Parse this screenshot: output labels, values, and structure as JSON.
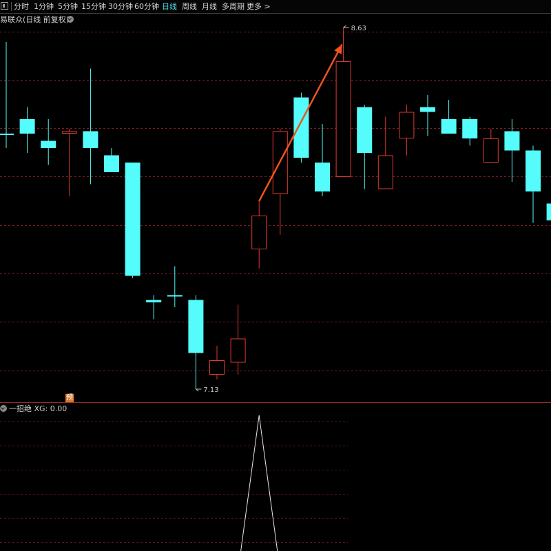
{
  "toolbar": {
    "periods": [
      "分时",
      "1分钟",
      "5分钟",
      "15分钟",
      "30分钟",
      "60分钟",
      "日线",
      "周线",
      "月线",
      "多周期",
      "更多 >"
    ],
    "active_period": "日线"
  },
  "main_pane": {
    "title": "易联众(日线 前复权)",
    "high_label": "8.63",
    "low_label": "7.13"
  },
  "indicator_pane": {
    "title": "一招绝  XG: 0.00"
  },
  "badge": "预",
  "colors": {
    "up": "#e03a2f",
    "down": "#54fcfc",
    "grid": "#7a1c1c",
    "arrow": "#f0531e",
    "active_tab": "#4ee0ee"
  },
  "chart_data": {
    "type": "candlestick",
    "price_range": [
      7.13,
      8.63
    ],
    "candles": [
      {
        "open": 8.19,
        "close": 8.19,
        "high": 8.57,
        "low": 8.13
      },
      {
        "open": 8.25,
        "close": 8.19,
        "high": 8.3,
        "low": 8.11
      },
      {
        "open": 8.16,
        "close": 8.13,
        "high": 8.25,
        "low": 8.06
      },
      {
        "open": 8.19,
        "close": 8.2,
        "high": 8.21,
        "low": 7.93
      },
      {
        "open": 8.2,
        "close": 8.13,
        "high": 8.46,
        "low": 7.98
      },
      {
        "open": 8.1,
        "close": 8.03,
        "high": 8.13,
        "low": 8.03
      },
      {
        "open": 8.07,
        "close": 7.6,
        "high": 8.07,
        "low": 7.59
      },
      {
        "open": 7.5,
        "close": 7.49,
        "high": 7.52,
        "low": 7.42
      },
      {
        "open": 7.52,
        "close": 7.52,
        "high": 7.64,
        "low": 7.47
      },
      {
        "open": 7.5,
        "close": 7.28,
        "high": 7.52,
        "low": 7.13
      },
      {
        "open": 7.19,
        "close": 7.25,
        "high": 7.31,
        "low": 7.17
      },
      {
        "open": 7.24,
        "close": 7.34,
        "high": 7.48,
        "low": 7.19
      },
      {
        "open": 7.71,
        "close": 7.85,
        "high": 7.91,
        "low": 7.63
      },
      {
        "open": 7.94,
        "close": 8.2,
        "high": 8.21,
        "low": 7.77
      },
      {
        "open": 8.34,
        "close": 8.09,
        "high": 8.36,
        "low": 8.07
      },
      {
        "open": 8.07,
        "close": 7.95,
        "high": 8.23,
        "low": 7.93
      },
      {
        "open": 8.01,
        "close": 8.49,
        "high": 8.63,
        "low": 8.01
      },
      {
        "open": 8.3,
        "close": 8.11,
        "high": 8.31,
        "low": 7.96
      },
      {
        "open": 7.96,
        "close": 8.1,
        "high": 8.26,
        "low": 7.98
      },
      {
        "open": 8.17,
        "close": 8.28,
        "high": 8.31,
        "low": 8.1
      },
      {
        "open": 8.3,
        "close": 8.28,
        "high": 8.35,
        "low": 8.18
      },
      {
        "open": 8.25,
        "close": 8.19,
        "high": 8.33,
        "low": 8.2
      },
      {
        "open": 8.25,
        "close": 8.17,
        "high": 8.26,
        "low": 8.14
      },
      {
        "open": 8.07,
        "close": 8.17,
        "high": 8.21,
        "low": 8.1
      },
      {
        "open": 8.2,
        "close": 8.12,
        "high": 8.25,
        "low": 7.99
      },
      {
        "open": 8.12,
        "close": 7.95,
        "high": 8.14,
        "low": 7.82
      },
      {
        "open": 7.9,
        "close": 7.83,
        "high": 7.91,
        "low": 7.71
      }
    ],
    "xg_signal": [
      0,
      0,
      0,
      0,
      0,
      0,
      0,
      0,
      0,
      0,
      0,
      0,
      1,
      0,
      0,
      0,
      0,
      0,
      0,
      0,
      0,
      0,
      0,
      0,
      0,
      0,
      0
    ]
  }
}
